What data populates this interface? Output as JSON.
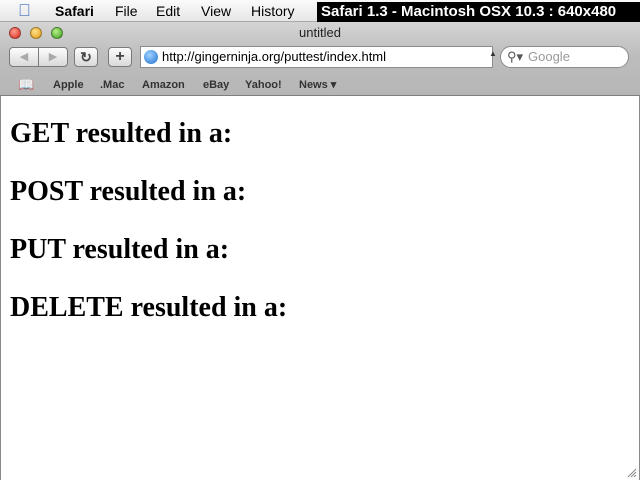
{
  "menubar": {
    "apple_icon": "apple-logo",
    "items": [
      "Safari",
      "File",
      "Edit",
      "View",
      "History"
    ],
    "banner": "Safari 1.3 - Macintosh OSX 10.3 : 640x480"
  },
  "window": {
    "title": "untitled"
  },
  "toolbar": {
    "back_icon": "◀",
    "forward_icon": "▶",
    "reload_icon": "↻",
    "add_icon": "+",
    "url": "http://gingerninja.org/puttest/index.html",
    "search_placeholder": "Google",
    "search_icon": "search-icon"
  },
  "bookmarks": {
    "book_icon": "📖",
    "items": [
      "Apple",
      ".Mac",
      "Amazon",
      "eBay",
      "Yahoo!",
      "News ▾"
    ]
  },
  "content": {
    "headings": [
      "GET resulted in a:",
      "POST resulted in a:",
      "PUT resulted in a:",
      "DELETE resulted in a:"
    ]
  }
}
